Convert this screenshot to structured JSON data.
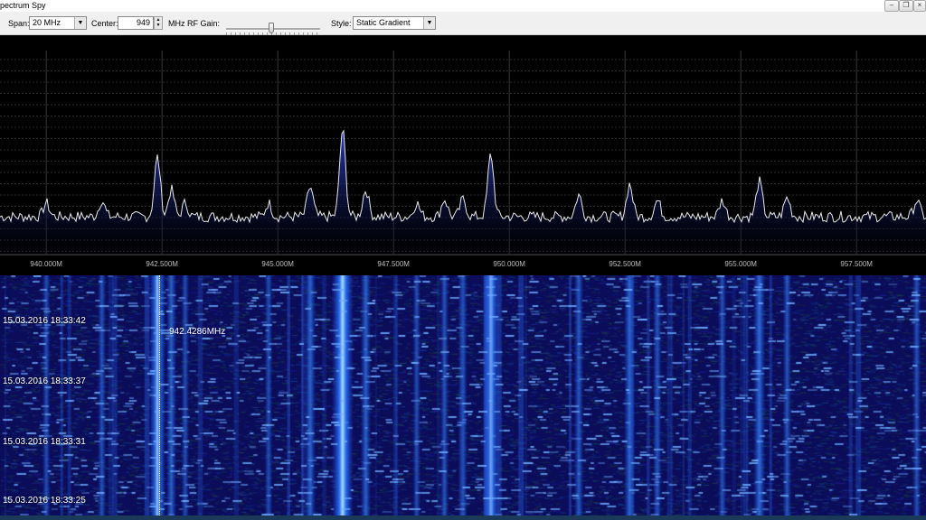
{
  "window": {
    "title": "pectrum Spy",
    "controls": [
      "minimize",
      "restore",
      "close"
    ]
  },
  "toolbar": {
    "span_label": "Span:",
    "span_value": "20 MHz",
    "center_label": "Center:",
    "center_value": "949",
    "center_unit": "MHz",
    "rfgain_label": "RF Gain:",
    "rfgain_level": 0.48,
    "style_label": "Style:",
    "style_value": "Static Gradient"
  },
  "spectrum": {
    "tick_labels": [
      "940.000M",
      "942.500M",
      "945.000M",
      "947.500M",
      "950.000M",
      "952.500M",
      "955.000M",
      "957.500M"
    ],
    "tick_freqs_mhz": [
      940,
      942.5,
      945,
      947.5,
      950,
      952.5,
      955,
      957.5
    ],
    "freq_range_mhz": [
      939,
      959
    ],
    "grid": true,
    "line_color": "#e8e8e8",
    "fill_color": "#1a2a80"
  },
  "chart_data": {
    "type": "line",
    "x_unit": "MHz",
    "xlim": [
      939,
      959
    ],
    "peaks": [
      {
        "freq": 940.0,
        "level": 0.1
      },
      {
        "freq": 941.2,
        "level": 0.12
      },
      {
        "freq": 942.4,
        "level": 0.44
      },
      {
        "freq": 942.7,
        "level": 0.2
      },
      {
        "freq": 943.0,
        "level": 0.1
      },
      {
        "freq": 944.8,
        "level": 0.1
      },
      {
        "freq": 945.7,
        "level": 0.22
      },
      {
        "freq": 946.4,
        "level": 0.64
      },
      {
        "freq": 946.9,
        "level": 0.2
      },
      {
        "freq": 948.0,
        "level": 0.1
      },
      {
        "freq": 948.6,
        "level": 0.13
      },
      {
        "freq": 949.0,
        "level": 0.13
      },
      {
        "freq": 949.6,
        "level": 0.46
      },
      {
        "freq": 951.5,
        "level": 0.16
      },
      {
        "freq": 952.6,
        "level": 0.24
      },
      {
        "freq": 953.2,
        "level": 0.12
      },
      {
        "freq": 954.6,
        "level": 0.12
      },
      {
        "freq": 955.4,
        "level": 0.26
      },
      {
        "freq": 956.0,
        "level": 0.14
      },
      {
        "freq": 958.8,
        "level": 0.12
      }
    ]
  },
  "waterfall": {
    "timestamps": [
      "15.03.2016 18:33:42",
      "15.03.2016 18:33:37",
      "15.03.2016 18:33:31",
      "15.03.2016 18:33:25"
    ],
    "cursor_freq_label": "942.4286MHz",
    "colors": [
      "#0a0a55",
      "#1a3cc8",
      "#3d8ef0",
      "#c8e8ff"
    ]
  }
}
